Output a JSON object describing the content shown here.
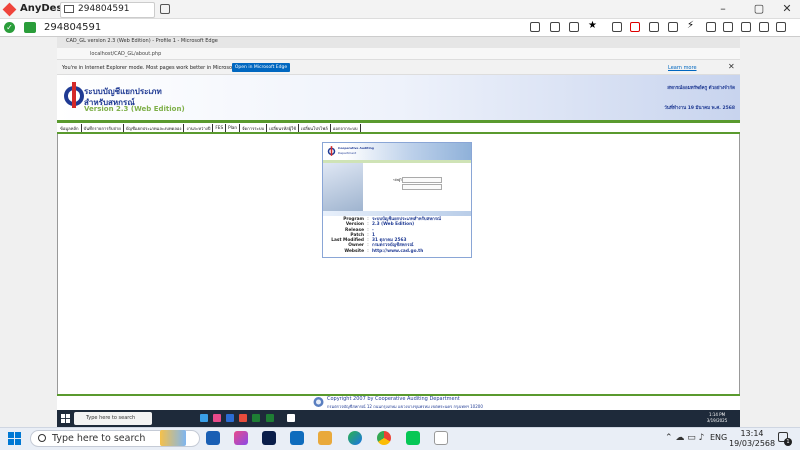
{
  "anydesk": {
    "app_name": "AnyDesk",
    "tab_id": "294804591",
    "address": "294804591",
    "window_controls": [
      "–",
      "▢",
      "✕"
    ]
  },
  "edge": {
    "title": "CAD_GL version 2.3 (Web Edition) - Profile 1 - Microsoft Edge",
    "url": "localhost/CAD_GL/about.php",
    "ie_banner": "You're in Internet Explorer mode. Most pages work better in Microsoft Edge.",
    "open_button": "Open in Microsoft Edge",
    "learn_more": "Learn more"
  },
  "header": {
    "title_line1": "ระบบบัญชีแยกประเภท",
    "title_line2": "สำหรับสหกรณ์",
    "title_line3": "Version 2.3 (Web Edition)",
    "right_line1": "สหกรณ์ออมทรัพย์ครู ตัวอย่างจำกัด",
    "right_line2": "วันที่ทำงาน 19 มีนาคม พ.ศ. 2568"
  },
  "menu": [
    "ข้อมูลหลัก",
    "บันทึกรายการรับจ่าย",
    "บัญชีแยกประเภทและงบทดลอง",
    "งานระหว่างปี",
    "FES",
    "Plan",
    "จัดการระบบ",
    "เปลี่ยนรหัสผู้ใช้",
    "เปลี่ยนโปรไฟล์",
    "ออกจากระบบ"
  ],
  "panel": {
    "brand1": "Cooperative Auditing",
    "brand2": "Department",
    "login_label": "รหัสผู้ใช้"
  },
  "about": [
    {
      "k": "Program",
      "v": "ระบบบัญชีแยกประเภทสำหรับสหกรณ์"
    },
    {
      "k": "Version",
      "v": "2.3 (Web Edition)"
    },
    {
      "k": "Release",
      "v": "-"
    },
    {
      "k": "Patch",
      "v": "1"
    },
    {
      "k": "Last Modified",
      "v": "31 ตุลาคม 2563"
    },
    {
      "k": "Owner",
      "v": "กรมตรวจบัญชีสหกรณ์"
    },
    {
      "k": "Website",
      "v": "http://www.cad.go.th"
    }
  ],
  "footer": {
    "line1": "Copyright 2007 by Cooperative Auditing Department",
    "line2": "กรมตรวจบัญชีสหกรณ์ 12 ถนนกรุงเกษม แขวงบางขุนพรหม เขตพระนคร กรุงเทพฯ 10200"
  },
  "inner_taskbar": {
    "search_placeholder": "Type here to search",
    "time": "1:14 PM",
    "date": "3/19/2025"
  },
  "taskbar": {
    "search_placeholder": "Type here to search",
    "lang": "ENG",
    "time": "13:14",
    "date": "19/03/2568",
    "notif_count": "1"
  },
  "colors": {
    "green": "#5a9a2e",
    "blue": "#1f3a93",
    "edge_button": "#0067c0"
  }
}
